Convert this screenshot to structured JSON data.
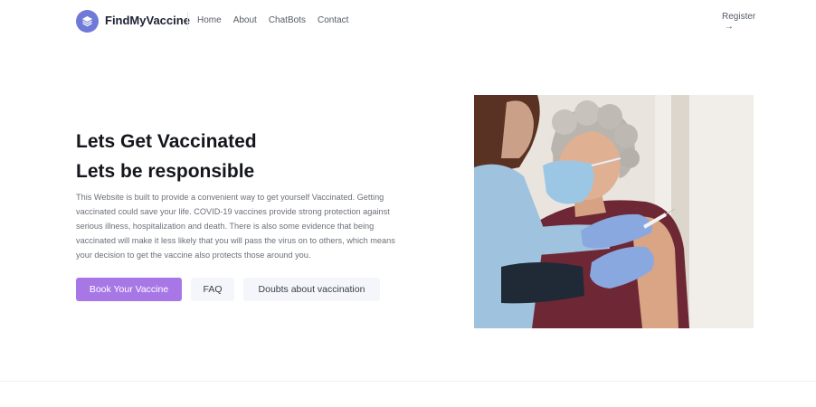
{
  "header": {
    "brand": "FindMyVaccine",
    "logo_icon": "stack-layers-icon",
    "nav": [
      "Home",
      "About",
      "ChatBots",
      "Contact"
    ],
    "register_label": "Register",
    "register_icon": "arrow-right-icon"
  },
  "hero": {
    "title_line1": "Lets Get Vaccinated",
    "title_line2": "Lets be responsible",
    "description": "This Website is built to provide a convenient way to get yourself Vaccinated. Getting vaccinated could save your life. COVID-19 vaccines provide strong protection against serious illness, hospitalization and death. There is also some evidence that being vaccinated will make it less likely that you will pass the virus on to others, which means your decision to get the vaccine also protects those around you.",
    "buttons": {
      "primary": "Book Your Vaccine",
      "faq": "FAQ",
      "doubts": "Doubts about vaccination"
    },
    "image_subject": "healthcare worker vaccinating elderly woman"
  },
  "colors": {
    "accent": "#a877e6",
    "logo": "#6f79d8",
    "light_button": "#f4f6fb"
  }
}
